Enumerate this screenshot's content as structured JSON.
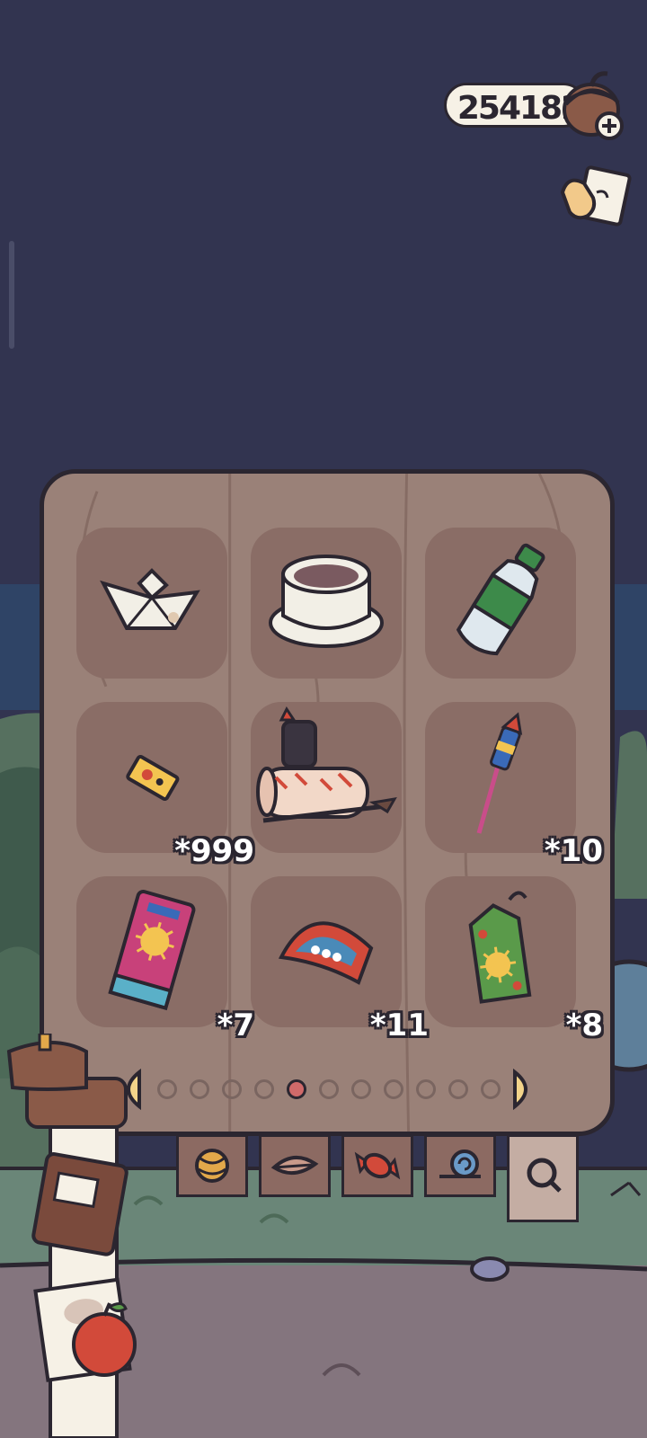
{
  "currency": {
    "amount": "254182",
    "icon": "acorn-icon",
    "add_icon": "plus-icon"
  },
  "top_right_icon": "card-hand-icon",
  "inventory": {
    "items": [
      {
        "name": "paper-boat",
        "count": ""
      },
      {
        "name": "bowl-of-soup",
        "count": ""
      },
      {
        "name": "soda-bottle",
        "count": ""
      },
      {
        "name": "ticket",
        "count": "*999"
      },
      {
        "name": "painting-kit",
        "count": ""
      },
      {
        "name": "firework-rocket",
        "count": "*10"
      },
      {
        "name": "patterned-box",
        "count": "*7"
      },
      {
        "name": "striped-fan",
        "count": "*11"
      },
      {
        "name": "lantern-box",
        "count": "*8"
      }
    ],
    "page_count": 11,
    "active_page": 5
  },
  "tabs": [
    {
      "name": "yarn-ball",
      "icon": "yarn-icon"
    },
    {
      "name": "leaf",
      "icon": "leaf-icon"
    },
    {
      "name": "candy",
      "icon": "candy-icon"
    },
    {
      "name": "snail",
      "icon": "snail-icon"
    },
    {
      "name": "search",
      "icon": "search-icon"
    }
  ],
  "colors": {
    "sky": "#323450",
    "panel": "#9a8178",
    "slot": "#8a6d66",
    "outline": "#2b2630",
    "active_dot": "#d06a6a"
  }
}
